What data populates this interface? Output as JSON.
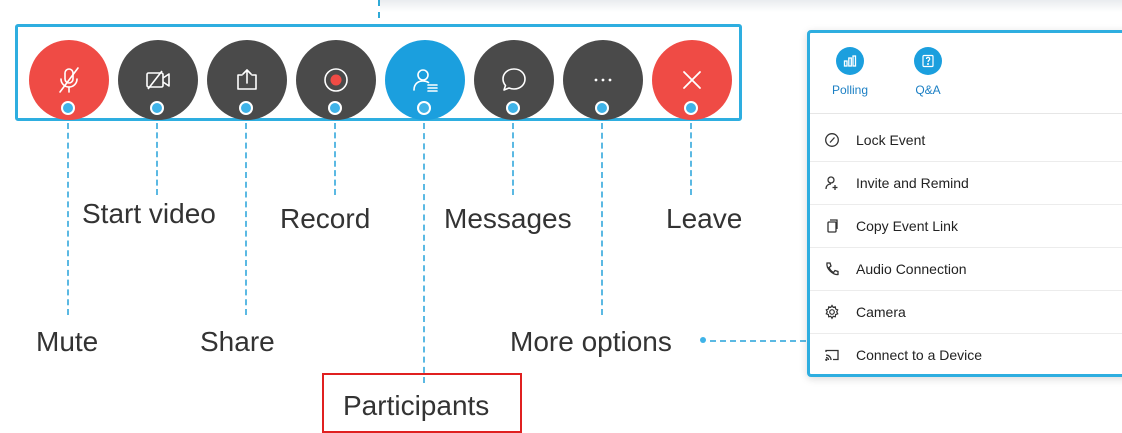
{
  "toolbar": {
    "buttons": [
      {
        "name": "mute",
        "icon": "microphone-muted-icon",
        "color": "#ef4b45"
      },
      {
        "name": "start-video",
        "icon": "video-off-icon",
        "color": "#4a4a4a"
      },
      {
        "name": "share",
        "icon": "share-icon",
        "color": "#4a4a4a"
      },
      {
        "name": "record",
        "icon": "record-icon",
        "color": "#4a4a4a"
      },
      {
        "name": "participants",
        "icon": "participants-icon",
        "color": "#1b9fde"
      },
      {
        "name": "messages",
        "icon": "chat-bubble-icon",
        "color": "#4a4a4a"
      },
      {
        "name": "more-options",
        "icon": "ellipsis-icon",
        "color": "#4a4a4a"
      },
      {
        "name": "leave",
        "icon": "close-icon",
        "color": "#ef4b45"
      }
    ]
  },
  "labels": {
    "mute": "Mute",
    "start_video": "Start video",
    "share": "Share",
    "record": "Record",
    "participants": "Participants",
    "messages": "Messages",
    "more_options": "More options",
    "leave": "Leave"
  },
  "panel": {
    "top_buttons": [
      {
        "label": "Polling",
        "icon": "polling-icon"
      },
      {
        "label": "Q&A",
        "icon": "qa-icon"
      }
    ],
    "menu": [
      {
        "label": "Lock Event",
        "icon": "lock-icon"
      },
      {
        "label": "Invite and Remind",
        "icon": "invite-user-icon"
      },
      {
        "label": "Copy Event Link",
        "icon": "copy-icon"
      },
      {
        "label": "Audio Connection",
        "icon": "phone-icon"
      },
      {
        "label": "Camera",
        "icon": "gear-icon"
      },
      {
        "label": "Connect to a Device",
        "icon": "cast-icon"
      }
    ]
  },
  "colors": {
    "accent_blue": "#2eaee0",
    "red": "#ef4b45",
    "dark_button": "#4a4a4a",
    "highlight_box": "#e02020"
  }
}
